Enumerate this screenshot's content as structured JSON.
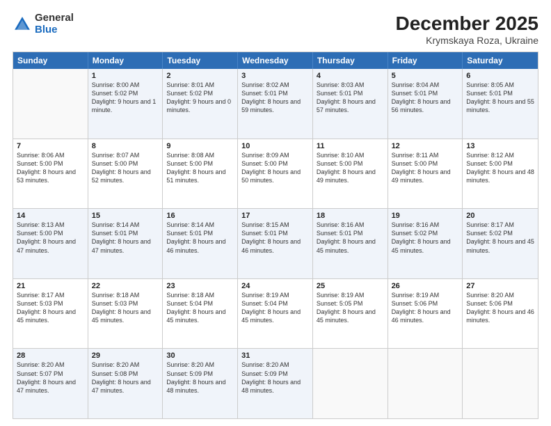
{
  "header": {
    "logo_general": "General",
    "logo_blue": "Blue",
    "month": "December 2025",
    "location": "Krymskaya Roza, Ukraine"
  },
  "weekdays": [
    "Sunday",
    "Monday",
    "Tuesday",
    "Wednesday",
    "Thursday",
    "Friday",
    "Saturday"
  ],
  "rows": [
    [
      {
        "day": "",
        "sunrise": "",
        "sunset": "",
        "daylight": ""
      },
      {
        "day": "1",
        "sunrise": "Sunrise: 8:00 AM",
        "sunset": "Sunset: 5:02 PM",
        "daylight": "Daylight: 9 hours and 1 minute."
      },
      {
        "day": "2",
        "sunrise": "Sunrise: 8:01 AM",
        "sunset": "Sunset: 5:02 PM",
        "daylight": "Daylight: 9 hours and 0 minutes."
      },
      {
        "day": "3",
        "sunrise": "Sunrise: 8:02 AM",
        "sunset": "Sunset: 5:01 PM",
        "daylight": "Daylight: 8 hours and 59 minutes."
      },
      {
        "day": "4",
        "sunrise": "Sunrise: 8:03 AM",
        "sunset": "Sunset: 5:01 PM",
        "daylight": "Daylight: 8 hours and 57 minutes."
      },
      {
        "day": "5",
        "sunrise": "Sunrise: 8:04 AM",
        "sunset": "Sunset: 5:01 PM",
        "daylight": "Daylight: 8 hours and 56 minutes."
      },
      {
        "day": "6",
        "sunrise": "Sunrise: 8:05 AM",
        "sunset": "Sunset: 5:01 PM",
        "daylight": "Daylight: 8 hours and 55 minutes."
      }
    ],
    [
      {
        "day": "7",
        "sunrise": "Sunrise: 8:06 AM",
        "sunset": "Sunset: 5:00 PM",
        "daylight": "Daylight: 8 hours and 53 minutes."
      },
      {
        "day": "8",
        "sunrise": "Sunrise: 8:07 AM",
        "sunset": "Sunset: 5:00 PM",
        "daylight": "Daylight: 8 hours and 52 minutes."
      },
      {
        "day": "9",
        "sunrise": "Sunrise: 8:08 AM",
        "sunset": "Sunset: 5:00 PM",
        "daylight": "Daylight: 8 hours and 51 minutes."
      },
      {
        "day": "10",
        "sunrise": "Sunrise: 8:09 AM",
        "sunset": "Sunset: 5:00 PM",
        "daylight": "Daylight: 8 hours and 50 minutes."
      },
      {
        "day": "11",
        "sunrise": "Sunrise: 8:10 AM",
        "sunset": "Sunset: 5:00 PM",
        "daylight": "Daylight: 8 hours and 49 minutes."
      },
      {
        "day": "12",
        "sunrise": "Sunrise: 8:11 AM",
        "sunset": "Sunset: 5:00 PM",
        "daylight": "Daylight: 8 hours and 49 minutes."
      },
      {
        "day": "13",
        "sunrise": "Sunrise: 8:12 AM",
        "sunset": "Sunset: 5:00 PM",
        "daylight": "Daylight: 8 hours and 48 minutes."
      }
    ],
    [
      {
        "day": "14",
        "sunrise": "Sunrise: 8:13 AM",
        "sunset": "Sunset: 5:00 PM",
        "daylight": "Daylight: 8 hours and 47 minutes."
      },
      {
        "day": "15",
        "sunrise": "Sunrise: 8:14 AM",
        "sunset": "Sunset: 5:01 PM",
        "daylight": "Daylight: 8 hours and 47 minutes."
      },
      {
        "day": "16",
        "sunrise": "Sunrise: 8:14 AM",
        "sunset": "Sunset: 5:01 PM",
        "daylight": "Daylight: 8 hours and 46 minutes."
      },
      {
        "day": "17",
        "sunrise": "Sunrise: 8:15 AM",
        "sunset": "Sunset: 5:01 PM",
        "daylight": "Daylight: 8 hours and 46 minutes."
      },
      {
        "day": "18",
        "sunrise": "Sunrise: 8:16 AM",
        "sunset": "Sunset: 5:01 PM",
        "daylight": "Daylight: 8 hours and 45 minutes."
      },
      {
        "day": "19",
        "sunrise": "Sunrise: 8:16 AM",
        "sunset": "Sunset: 5:02 PM",
        "daylight": "Daylight: 8 hours and 45 minutes."
      },
      {
        "day": "20",
        "sunrise": "Sunrise: 8:17 AM",
        "sunset": "Sunset: 5:02 PM",
        "daylight": "Daylight: 8 hours and 45 minutes."
      }
    ],
    [
      {
        "day": "21",
        "sunrise": "Sunrise: 8:17 AM",
        "sunset": "Sunset: 5:03 PM",
        "daylight": "Daylight: 8 hours and 45 minutes."
      },
      {
        "day": "22",
        "sunrise": "Sunrise: 8:18 AM",
        "sunset": "Sunset: 5:03 PM",
        "daylight": "Daylight: 8 hours and 45 minutes."
      },
      {
        "day": "23",
        "sunrise": "Sunrise: 8:18 AM",
        "sunset": "Sunset: 5:04 PM",
        "daylight": "Daylight: 8 hours and 45 minutes."
      },
      {
        "day": "24",
        "sunrise": "Sunrise: 8:19 AM",
        "sunset": "Sunset: 5:04 PM",
        "daylight": "Daylight: 8 hours and 45 minutes."
      },
      {
        "day": "25",
        "sunrise": "Sunrise: 8:19 AM",
        "sunset": "Sunset: 5:05 PM",
        "daylight": "Daylight: 8 hours and 45 minutes."
      },
      {
        "day": "26",
        "sunrise": "Sunrise: 8:19 AM",
        "sunset": "Sunset: 5:06 PM",
        "daylight": "Daylight: 8 hours and 46 minutes."
      },
      {
        "day": "27",
        "sunrise": "Sunrise: 8:20 AM",
        "sunset": "Sunset: 5:06 PM",
        "daylight": "Daylight: 8 hours and 46 minutes."
      }
    ],
    [
      {
        "day": "28",
        "sunrise": "Sunrise: 8:20 AM",
        "sunset": "Sunset: 5:07 PM",
        "daylight": "Daylight: 8 hours and 47 minutes."
      },
      {
        "day": "29",
        "sunrise": "Sunrise: 8:20 AM",
        "sunset": "Sunset: 5:08 PM",
        "daylight": "Daylight: 8 hours and 47 minutes."
      },
      {
        "day": "30",
        "sunrise": "Sunrise: 8:20 AM",
        "sunset": "Sunset: 5:09 PM",
        "daylight": "Daylight: 8 hours and 48 minutes."
      },
      {
        "day": "31",
        "sunrise": "Sunrise: 8:20 AM",
        "sunset": "Sunset: 5:09 PM",
        "daylight": "Daylight: 8 hours and 48 minutes."
      },
      {
        "day": "",
        "sunrise": "",
        "sunset": "",
        "daylight": ""
      },
      {
        "day": "",
        "sunrise": "",
        "sunset": "",
        "daylight": ""
      },
      {
        "day": "",
        "sunrise": "",
        "sunset": "",
        "daylight": ""
      }
    ]
  ]
}
